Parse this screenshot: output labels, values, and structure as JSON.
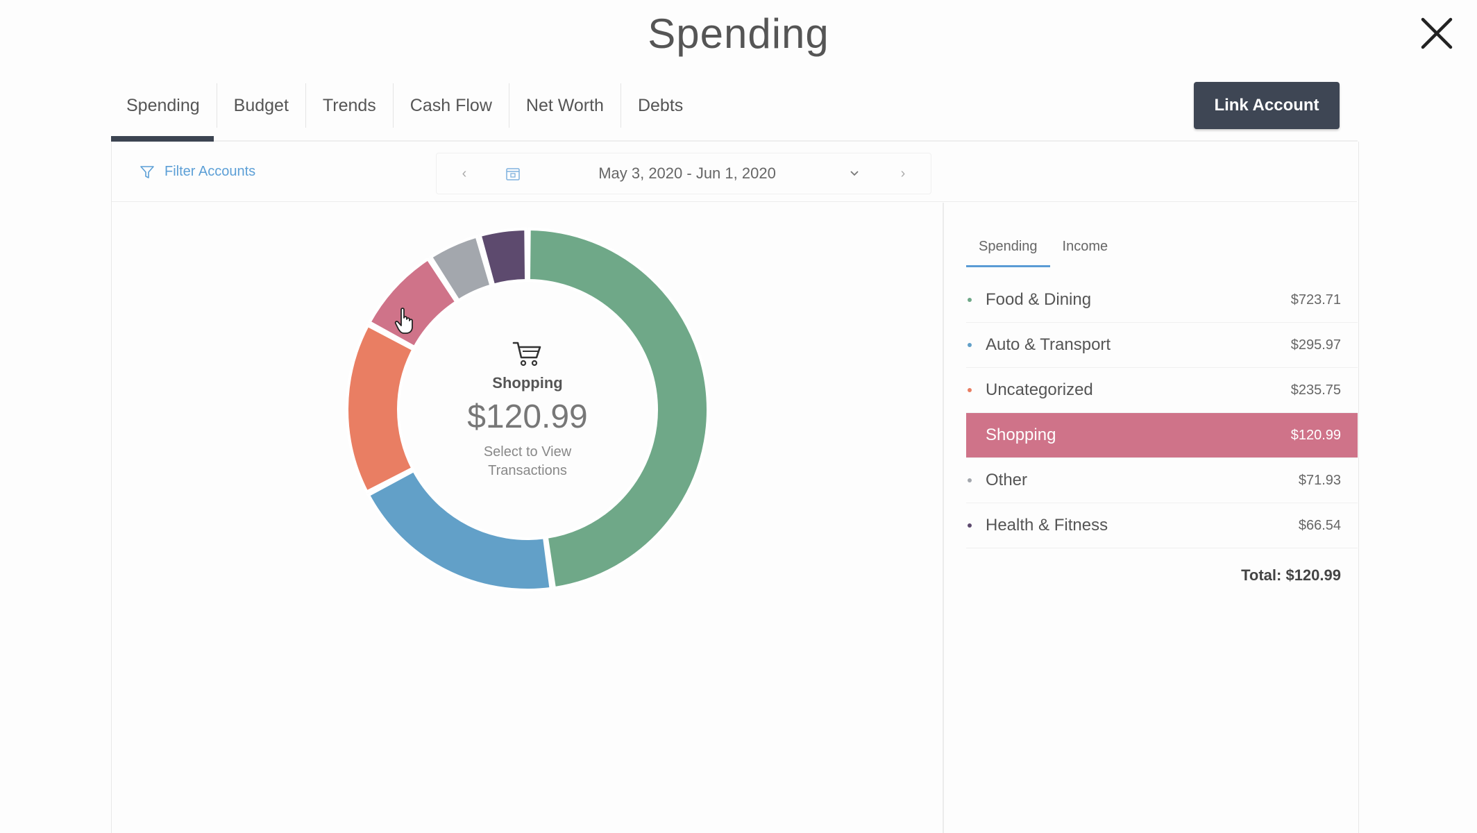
{
  "title": "Spending",
  "tabs": [
    {
      "label": "Spending",
      "active": true
    },
    {
      "label": "Budget",
      "active": false
    },
    {
      "label": "Trends",
      "active": false
    },
    {
      "label": "Cash Flow",
      "active": false
    },
    {
      "label": "Net Worth",
      "active": false
    },
    {
      "label": "Debts",
      "active": false
    }
  ],
  "link_account_label": "Link Account",
  "toolbar": {
    "filter_label": "Filter Accounts",
    "date_range": "May 3, 2020 - Jun 1, 2020",
    "prev_icon": "chevron-left-icon",
    "next_icon": "chevron-right-icon",
    "calendar_icon": "calendar-icon"
  },
  "center": {
    "icon": "shopping-cart-icon",
    "label": "Shopping",
    "amount": "$120.99",
    "hint": "Select to View Transactions"
  },
  "side_tabs": [
    {
      "label": "Spending",
      "active": true
    },
    {
      "label": "Income",
      "active": false
    }
  ],
  "categories": [
    {
      "label": "Food & Dining",
      "amount": "$723.71",
      "value": 723.71,
      "color": "#6fa888",
      "selected": false
    },
    {
      "label": "Auto & Transport",
      "amount": "$295.97",
      "value": 295.97,
      "color": "#62a0c8",
      "selected": false
    },
    {
      "label": "Uncategorized",
      "amount": "$235.75",
      "value": 235.75,
      "color": "#e97e63",
      "selected": false
    },
    {
      "label": "Shopping",
      "amount": "$120.99",
      "value": 120.99,
      "color": "#cf7389",
      "selected": true
    },
    {
      "label": "Other",
      "amount": "$71.93",
      "value": 71.93,
      "color": "#a3a7ad",
      "selected": false
    },
    {
      "label": "Health & Fitness",
      "amount": "$66.54",
      "value": 66.54,
      "color": "#5d4a6e",
      "selected": false
    }
  ],
  "total": "Total: $120.99",
  "colors": {
    "accent": "#5a9bd5",
    "button_bg": "#3e4654",
    "selected_row": "#cf7389"
  }
}
